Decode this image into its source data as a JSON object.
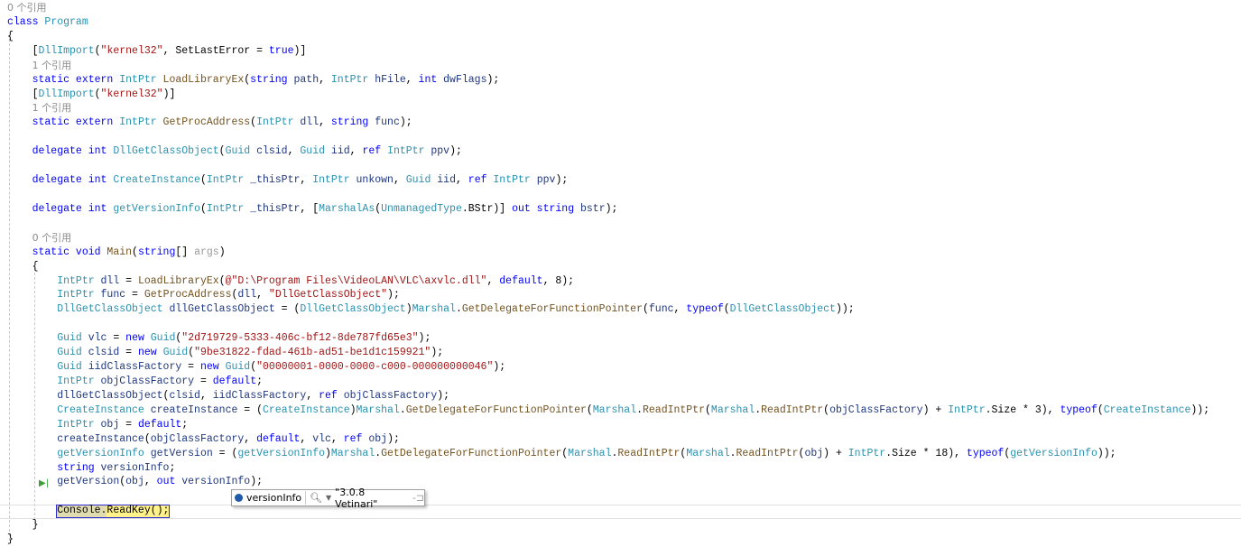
{
  "lines": [
    [
      [
        "0 个引用",
        "c"
      ]
    ],
    [
      [
        "class ",
        "k"
      ],
      [
        "Program",
        "t"
      ]
    ],
    [
      [
        "{",
        "p"
      ]
    ],
    [
      [
        "    [",
        "p"
      ],
      [
        "DllImport",
        "t"
      ],
      [
        "(",
        "p"
      ],
      [
        "\"kernel32\"",
        "s"
      ],
      [
        ", SetLastError = ",
        "p"
      ],
      [
        "true",
        "k"
      ],
      [
        ")]",
        "p"
      ]
    ],
    [
      [
        "    ",
        "p"
      ],
      [
        "1 个引用",
        "c"
      ]
    ],
    [
      [
        "    static extern ",
        "k"
      ],
      [
        "IntPtr ",
        "t"
      ],
      [
        "LoadLibraryEx",
        "m"
      ],
      [
        "(",
        "p"
      ],
      [
        "string ",
        "k"
      ],
      [
        "path",
        "v"
      ],
      [
        ", ",
        "p"
      ],
      [
        "IntPtr ",
        "t"
      ],
      [
        "hFile",
        "v"
      ],
      [
        ", ",
        "p"
      ],
      [
        "int ",
        "k"
      ],
      [
        "dwFlags",
        "v"
      ],
      [
        ");",
        "p"
      ]
    ],
    [
      [
        "    [",
        "p"
      ],
      [
        "DllImport",
        "t"
      ],
      [
        "(",
        "p"
      ],
      [
        "\"kernel32\"",
        "s"
      ],
      [
        ")]",
        "p"
      ]
    ],
    [
      [
        "    ",
        "p"
      ],
      [
        "1 个引用",
        "c"
      ]
    ],
    [
      [
        "    static extern ",
        "k"
      ],
      [
        "IntPtr ",
        "t"
      ],
      [
        "GetProcAddress",
        "m"
      ],
      [
        "(",
        "p"
      ],
      [
        "IntPtr ",
        "t"
      ],
      [
        "dll",
        "v"
      ],
      [
        ", ",
        "p"
      ],
      [
        "string ",
        "k"
      ],
      [
        "func",
        "v"
      ],
      [
        ");",
        "p"
      ]
    ],
    [],
    [
      [
        "    delegate int ",
        "k"
      ],
      [
        "DllGetClassObject",
        "t"
      ],
      [
        "(",
        "p"
      ],
      [
        "Guid ",
        "t"
      ],
      [
        "clsid",
        "v"
      ],
      [
        ", ",
        "p"
      ],
      [
        "Guid ",
        "t"
      ],
      [
        "iid",
        "v"
      ],
      [
        ", ",
        "p"
      ],
      [
        "ref ",
        "k"
      ],
      [
        "IntPtr ",
        "t"
      ],
      [
        "ppv",
        "v"
      ],
      [
        ");",
        "p"
      ]
    ],
    [],
    [
      [
        "    delegate int ",
        "k"
      ],
      [
        "CreateInstance",
        "t"
      ],
      [
        "(",
        "p"
      ],
      [
        "IntPtr ",
        "t"
      ],
      [
        "_thisPtr",
        "v"
      ],
      [
        ", ",
        "p"
      ],
      [
        "IntPtr ",
        "t"
      ],
      [
        "unkown",
        "v"
      ],
      [
        ", ",
        "p"
      ],
      [
        "Guid ",
        "t"
      ],
      [
        "iid",
        "v"
      ],
      [
        ", ",
        "p"
      ],
      [
        "ref ",
        "k"
      ],
      [
        "IntPtr ",
        "t"
      ],
      [
        "ppv",
        "v"
      ],
      [
        ");",
        "p"
      ]
    ],
    [],
    [
      [
        "    delegate int ",
        "k"
      ],
      [
        "getVersionInfo",
        "t"
      ],
      [
        "(",
        "p"
      ],
      [
        "IntPtr ",
        "t"
      ],
      [
        "_thisPtr",
        "v"
      ],
      [
        ", [",
        "p"
      ],
      [
        "MarshalAs",
        "t"
      ],
      [
        "(",
        "p"
      ],
      [
        "UnmanagedType",
        "t"
      ],
      [
        ".BStr)] ",
        "p"
      ],
      [
        "out string ",
        "k"
      ],
      [
        "bstr",
        "v"
      ],
      [
        ");",
        "p"
      ]
    ],
    [],
    [
      [
        "    ",
        "p"
      ],
      [
        "0 个引用",
        "c"
      ]
    ],
    [
      [
        "    static void ",
        "k"
      ],
      [
        "Main",
        "m"
      ],
      [
        "(",
        "p"
      ],
      [
        "string",
        "k"
      ],
      [
        "[] ",
        "p"
      ],
      [
        "args",
        "u"
      ],
      [
        ")",
        "p"
      ]
    ],
    [
      [
        "    {",
        "p"
      ]
    ],
    [
      [
        "        ",
        "p"
      ],
      [
        "IntPtr ",
        "t"
      ],
      [
        "dll",
        "v"
      ],
      [
        " = ",
        "p"
      ],
      [
        "LoadLibraryEx",
        "m"
      ],
      [
        "(",
        "p"
      ],
      [
        "@\"D:\\Program Files\\VideoLAN\\VLC\\axvlc.dll\"",
        "s"
      ],
      [
        ", ",
        "p"
      ],
      [
        "default",
        "k"
      ],
      [
        ", 8);",
        "p"
      ]
    ],
    [
      [
        "        ",
        "p"
      ],
      [
        "IntPtr ",
        "t"
      ],
      [
        "func",
        "v"
      ],
      [
        " = ",
        "p"
      ],
      [
        "GetProcAddress",
        "m"
      ],
      [
        "(",
        "p"
      ],
      [
        "dll",
        "v"
      ],
      [
        ", ",
        "p"
      ],
      [
        "\"DllGetClassObject\"",
        "s"
      ],
      [
        ");",
        "p"
      ]
    ],
    [
      [
        "        ",
        "p"
      ],
      [
        "DllGetClassObject ",
        "t"
      ],
      [
        "dllGetClassObject",
        "v"
      ],
      [
        " = (",
        "p"
      ],
      [
        "DllGetClassObject",
        "t"
      ],
      [
        ")",
        "p"
      ],
      [
        "Marshal",
        "t"
      ],
      [
        ".",
        "p"
      ],
      [
        "GetDelegateForFunctionPointer",
        "m"
      ],
      [
        "(",
        "p"
      ],
      [
        "func",
        "v"
      ],
      [
        ", ",
        "p"
      ],
      [
        "typeof",
        "k"
      ],
      [
        "(",
        "p"
      ],
      [
        "DllGetClassObject",
        "t"
      ],
      [
        "));",
        "p"
      ]
    ],
    [],
    [
      [
        "        ",
        "p"
      ],
      [
        "Guid ",
        "t"
      ],
      [
        "vlc",
        "v"
      ],
      [
        " = ",
        "p"
      ],
      [
        "new ",
        "k"
      ],
      [
        "Guid",
        "t"
      ],
      [
        "(",
        "p"
      ],
      [
        "\"2d719729-5333-406c-bf12-8de787fd65e3\"",
        "s"
      ],
      [
        ");",
        "p"
      ]
    ],
    [
      [
        "        ",
        "p"
      ],
      [
        "Guid ",
        "t"
      ],
      [
        "clsid",
        "v"
      ],
      [
        " = ",
        "p"
      ],
      [
        "new ",
        "k"
      ],
      [
        "Guid",
        "t"
      ],
      [
        "(",
        "p"
      ],
      [
        "\"9be31822-fdad-461b-ad51-be1d1c159921\"",
        "s"
      ],
      [
        ");",
        "p"
      ]
    ],
    [
      [
        "        ",
        "p"
      ],
      [
        "Guid ",
        "t"
      ],
      [
        "iidClassFactory",
        "v"
      ],
      [
        " = ",
        "p"
      ],
      [
        "new ",
        "k"
      ],
      [
        "Guid",
        "t"
      ],
      [
        "(",
        "p"
      ],
      [
        "\"00000001-0000-0000-c000-000000000046\"",
        "s"
      ],
      [
        ");",
        "p"
      ]
    ],
    [
      [
        "        ",
        "p"
      ],
      [
        "IntPtr ",
        "t"
      ],
      [
        "objClassFactory",
        "v"
      ],
      [
        " = ",
        "p"
      ],
      [
        "default",
        "k"
      ],
      [
        ";",
        "p"
      ]
    ],
    [
      [
        "        ",
        "p"
      ],
      [
        "dllGetClassObject",
        "v"
      ],
      [
        "(",
        "p"
      ],
      [
        "clsid",
        "v"
      ],
      [
        ", ",
        "p"
      ],
      [
        "iidClassFactory",
        "v"
      ],
      [
        ", ",
        "p"
      ],
      [
        "ref ",
        "k"
      ],
      [
        "objClassFactory",
        "v"
      ],
      [
        ");",
        "p"
      ]
    ],
    [
      [
        "        ",
        "p"
      ],
      [
        "CreateInstance ",
        "t"
      ],
      [
        "createInstance",
        "v"
      ],
      [
        " = (",
        "p"
      ],
      [
        "CreateInstance",
        "t"
      ],
      [
        ")",
        "p"
      ],
      [
        "Marshal",
        "t"
      ],
      [
        ".",
        "p"
      ],
      [
        "GetDelegateForFunctionPointer",
        "m"
      ],
      [
        "(",
        "p"
      ],
      [
        "Marshal",
        "t"
      ],
      [
        ".",
        "p"
      ],
      [
        "ReadIntPtr",
        "m"
      ],
      [
        "(",
        "p"
      ],
      [
        "Marshal",
        "t"
      ],
      [
        ".",
        "p"
      ],
      [
        "ReadIntPtr",
        "m"
      ],
      [
        "(",
        "p"
      ],
      [
        "objClassFactory",
        "v"
      ],
      [
        ") + ",
        "p"
      ],
      [
        "IntPtr",
        "t"
      ],
      [
        ".Size * 3), ",
        "p"
      ],
      [
        "typeof",
        "k"
      ],
      [
        "(",
        "p"
      ],
      [
        "CreateInstance",
        "t"
      ],
      [
        "));",
        "p"
      ]
    ],
    [
      [
        "        ",
        "p"
      ],
      [
        "IntPtr ",
        "t"
      ],
      [
        "obj",
        "v"
      ],
      [
        " = ",
        "p"
      ],
      [
        "default",
        "k"
      ],
      [
        ";",
        "p"
      ]
    ],
    [
      [
        "        ",
        "p"
      ],
      [
        "createInstance",
        "v"
      ],
      [
        "(",
        "p"
      ],
      [
        "objClassFactory",
        "v"
      ],
      [
        ", ",
        "p"
      ],
      [
        "default",
        "k"
      ],
      [
        ", ",
        "p"
      ],
      [
        "vlc",
        "v"
      ],
      [
        ", ",
        "p"
      ],
      [
        "ref ",
        "k"
      ],
      [
        "obj",
        "v"
      ],
      [
        ");",
        "p"
      ]
    ],
    [
      [
        "        ",
        "p"
      ],
      [
        "getVersionInfo ",
        "t"
      ],
      [
        "getVersion",
        "v"
      ],
      [
        " = (",
        "p"
      ],
      [
        "getVersionInfo",
        "t"
      ],
      [
        ")",
        "p"
      ],
      [
        "Marshal",
        "t"
      ],
      [
        ".",
        "p"
      ],
      [
        "GetDelegateForFunctionPointer",
        "m"
      ],
      [
        "(",
        "p"
      ],
      [
        "Marshal",
        "t"
      ],
      [
        ".",
        "p"
      ],
      [
        "ReadIntPtr",
        "m"
      ],
      [
        "(",
        "p"
      ],
      [
        "Marshal",
        "t"
      ],
      [
        ".",
        "p"
      ],
      [
        "ReadIntPtr",
        "m"
      ],
      [
        "(",
        "p"
      ],
      [
        "obj",
        "v"
      ],
      [
        ") + ",
        "p"
      ],
      [
        "IntPtr",
        "t"
      ],
      [
        ".Size * 18), ",
        "p"
      ],
      [
        "typeof",
        "k"
      ],
      [
        "(",
        "p"
      ],
      [
        "getVersionInfo",
        "t"
      ],
      [
        "));",
        "p"
      ]
    ],
    [
      [
        "        ",
        "p"
      ],
      [
        "string ",
        "k"
      ],
      [
        "versionInfo",
        "v"
      ],
      [
        ";",
        "p"
      ]
    ],
    [
      [
        "        ",
        "p"
      ],
      [
        "getVersion",
        "v"
      ],
      [
        "(",
        "p"
      ],
      [
        "obj",
        "v"
      ],
      [
        ", ",
        "p"
      ],
      [
        "out ",
        "k"
      ],
      [
        "versionInfo",
        "v"
      ],
      [
        ");",
        "p"
      ]
    ],
    [],
    [
      [
        "        Console.ReadKey();",
        "p"
      ]
    ],
    [
      [
        "    }",
        "p"
      ]
    ],
    [
      [
        "}",
        "p"
      ]
    ]
  ],
  "datatip": {
    "name": "versionInfo",
    "value": "\"3.0.8 Vetinari\""
  },
  "colors": {
    "keyword": "#0000ff",
    "type": "#2b91af",
    "method": "#74531f",
    "string": "#a31515",
    "local": "#1f377f",
    "highlight": "#fff28a"
  }
}
